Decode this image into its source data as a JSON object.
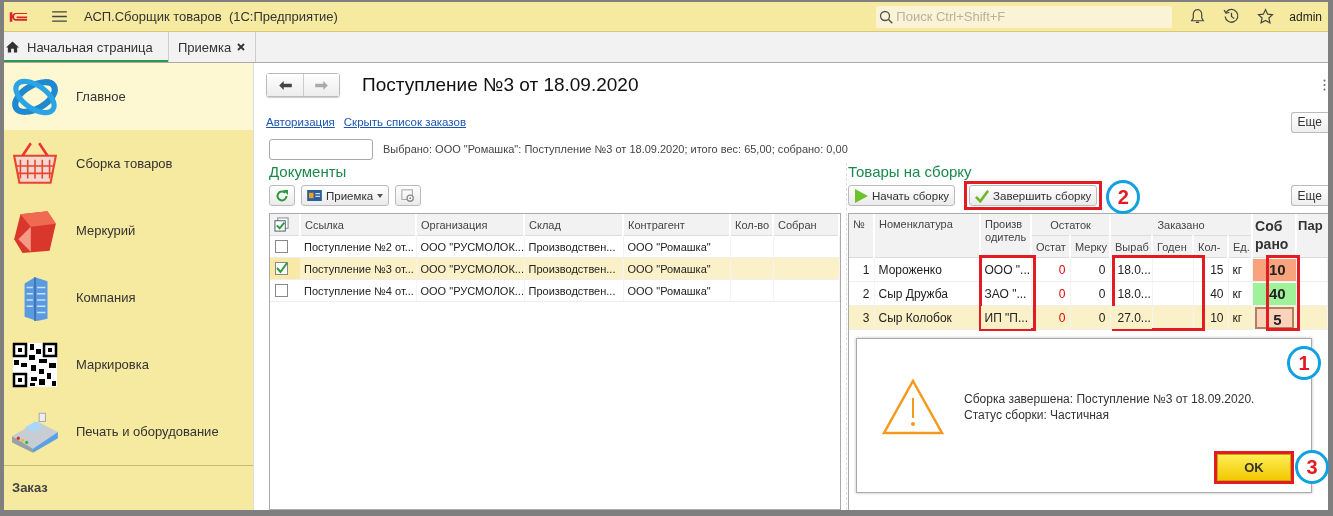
{
  "title_bar": {
    "app_title": "АСП.Сборщик товаров  (1С:Предприятие)",
    "search": {
      "placeholder": "Поиск Ctrl+Shift+F"
    },
    "user": "admin"
  },
  "tabs": [
    {
      "label": "Начальная страница",
      "selected": true,
      "kind": "home"
    },
    {
      "label": "Приемка",
      "selected": false,
      "kind": "closable"
    }
  ],
  "sidebar": {
    "items": [
      {
        "label": "Главное",
        "selected": true,
        "kind": "orbit"
      },
      {
        "label": "Сборка товаров",
        "selected": false,
        "kind": "basket"
      },
      {
        "label": "Меркурий",
        "selected": false,
        "kind": "cube"
      },
      {
        "label": "Компания",
        "selected": false,
        "kind": "building"
      },
      {
        "label": "Маркировка",
        "selected": false,
        "kind": "qr"
      },
      {
        "label": "Печать и оборудование",
        "selected": false,
        "kind": "terminal"
      }
    ],
    "footer": "Заказ"
  },
  "form": {
    "title": "Поступление №3 от 18.09.2020",
    "links": [
      "Авторизация",
      "Скрыть список заказов"
    ],
    "more_button": "Еще",
    "selection_text": "Выбрано: ООО \"Ромашка\": Поступление №3 от 18.09.2020; итого вес: 65,00; собрано: 0,00"
  },
  "documents": {
    "title": "Документы",
    "print_button": "Приемка",
    "columns": [
      "Ссылка",
      "Организация",
      "Склад",
      "Контрагент",
      "Кол-во",
      "Собран"
    ],
    "rows": [
      {
        "checked": false,
        "selected": false,
        "cells": [
          "Поступление №2 от...",
          "ООО \"РУСМОЛОК...",
          "Производствен...",
          "ООО \"Ромашка\"",
          "",
          ""
        ]
      },
      {
        "checked": true,
        "selected": true,
        "cells": [
          "Поступление №3 от...",
          "ООО \"РУСМОЛОК...",
          "Производствен...",
          "ООО \"Ромашка\"",
          "",
          ""
        ]
      },
      {
        "checked": false,
        "selected": false,
        "cells": [
          "Поступление №4 от...",
          "ООО \"РУСМОЛОК...",
          "Производствен...",
          "ООО \"Ромашка\"",
          "",
          ""
        ]
      }
    ]
  },
  "goods": {
    "title": "Товары на сборку",
    "buttons": [
      "Начать сборку",
      "Завершить сборку"
    ],
    "more_button": "Еще",
    "header": {
      "num": "№",
      "name": "Номенклатура",
      "producer": "Произв одитель",
      "stock": "Остаток",
      "stock_cols": [
        "Остат",
        "Мерку"
      ],
      "ordered": "Заказано",
      "ordered_cols": [
        "Выраб",
        "Годен",
        "Кол-",
        "Ед."
      ],
      "collected": "Соб рано",
      "column_11": "Пар"
    },
    "rows": [
      {
        "num": "1",
        "name": "Мороженко",
        "producer": "ООО \"...",
        "stock": "0",
        "merk": "0",
        "made": "18.0...",
        "expires": "",
        "qty": "15",
        "unit": "кг",
        "collected": "10",
        "color": "#f8a37e",
        "selected": false
      },
      {
        "num": "2",
        "name": "Сыр Дружба",
        "producer": "ЗАО \"...",
        "stock": "0",
        "merk": "0",
        "made": "18.0...",
        "expires": "",
        "qty": "40",
        "unit": "кг",
        "collected": "40",
        "color": "#9ff29a",
        "selected": false
      },
      {
        "num": "3",
        "name": "Сыр Колобок",
        "producer": "ИП \"П...",
        "stock": "0",
        "merk": "0",
        "made": "27.0...",
        "expires": "",
        "qty": "10",
        "unit": "кг",
        "collected": "5",
        "color": "#fbd3bd",
        "selected": true
      }
    ]
  },
  "dialog": {
    "lines": [
      "Сборка завершена: Поступление №3 от 18.09.2020.",
      "Статус сборки: Частичная"
    ],
    "ok_button": "OK"
  },
  "callouts": [
    "2",
    "1",
    "3"
  ]
}
